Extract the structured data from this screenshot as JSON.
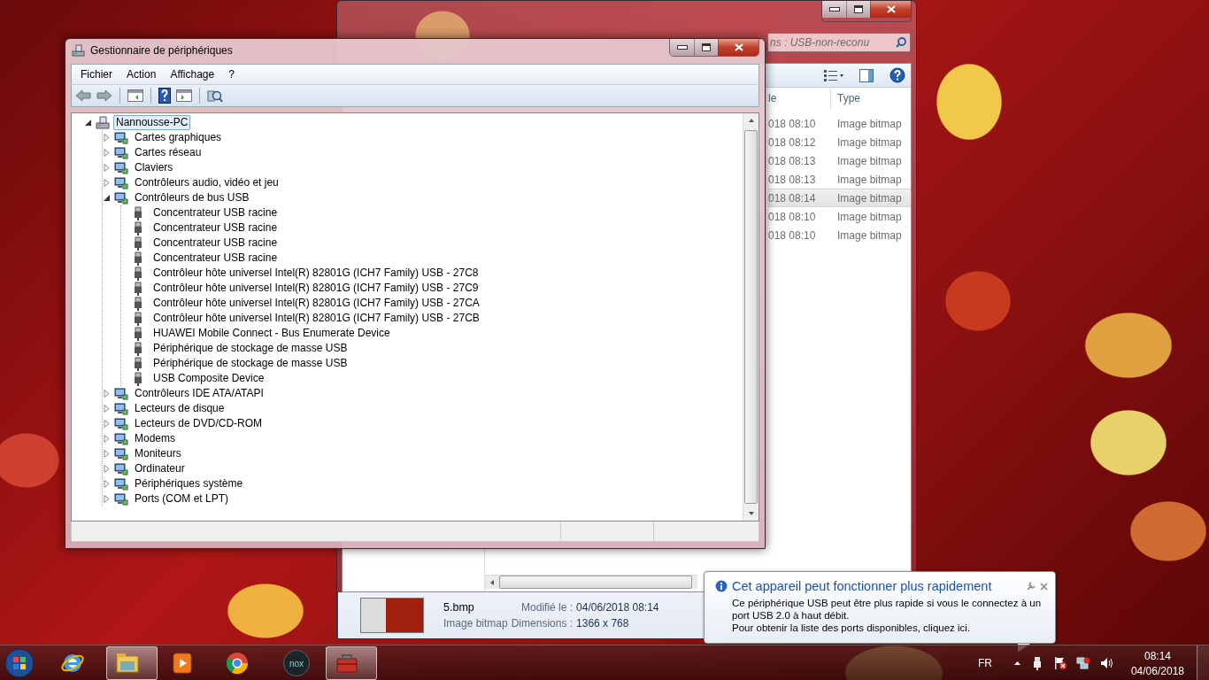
{
  "explorer": {
    "search": {
      "placeholder": "ns : USB-non-reconu"
    },
    "columns": [
      "le",
      "Type"
    ],
    "files": [
      {
        "date": "018 08:10",
        "type": "Image bitmap",
        "selected": false
      },
      {
        "date": "018 08:12",
        "type": "Image bitmap",
        "selected": false
      },
      {
        "date": "018 08:13",
        "type": "Image bitmap",
        "selected": false
      },
      {
        "date": "018 08:13",
        "type": "Image bitmap",
        "selected": false
      },
      {
        "date": "018 08:14",
        "type": "Image bitmap",
        "selected": true
      },
      {
        "date": "018 08:10",
        "type": "Image bitmap",
        "selected": false
      },
      {
        "date": "018 08:10",
        "type": "Image bitmap",
        "selected": false
      }
    ],
    "details": {
      "name": "5.bmp",
      "type": "Image bitmap",
      "fields": [
        {
          "label": "Modifié le :",
          "value": "04/06/2018 08:14"
        },
        {
          "label": "Dimensions :",
          "value": "1366 x 768"
        }
      ]
    }
  },
  "device_manager": {
    "title": "Gestionnaire de périphériques",
    "menu": [
      "Fichier",
      "Action",
      "Affichage",
      "?"
    ],
    "tree": [
      {
        "label": "Nannousse-PC",
        "expanded": true,
        "selected": true,
        "children": [
          {
            "label": "Cartes graphiques",
            "expanded": false,
            "selected": false
          },
          {
            "label": "Cartes réseau",
            "expanded": false,
            "selected": false
          },
          {
            "label": "Claviers",
            "expanded": false,
            "selected": false
          },
          {
            "label": "Contrôleurs audio, vidéo et jeu",
            "expanded": false,
            "selected": false
          },
          {
            "label": "Contrôleurs de bus USB",
            "expanded": true,
            "selected": false,
            "children": [
              {
                "label": "Concentrateur USB racine",
                "selected": false
              },
              {
                "label": "Concentrateur USB racine",
                "selected": false
              },
              {
                "label": "Concentrateur USB racine",
                "selected": false
              },
              {
                "label": "Concentrateur USB racine",
                "selected": false
              },
              {
                "label": "Contrôleur hôte universel Intel(R) 82801G (ICH7 Family) USB - 27C8",
                "selected": false
              },
              {
                "label": "Contrôleur hôte universel Intel(R) 82801G (ICH7 Family) USB - 27C9",
                "selected": false
              },
              {
                "label": "Contrôleur hôte universel Intel(R) 82801G (ICH7 Family) USB - 27CA",
                "selected": false
              },
              {
                "label": "Contrôleur hôte universel Intel(R) 82801G (ICH7 Family) USB - 27CB",
                "selected": false
              },
              {
                "label": "HUAWEI Mobile Connect - Bus Enumerate Device",
                "selected": false
              },
              {
                "label": "Périphérique de stockage de masse USB",
                "selected": false
              },
              {
                "label": "Périphérique de stockage de masse USB",
                "selected": false
              },
              {
                "label": "USB Composite Device",
                "selected": false
              }
            ]
          },
          {
            "label": "Contrôleurs IDE ATA/ATAPI",
            "expanded": false,
            "selected": false
          },
          {
            "label": "Lecteurs de disque",
            "expanded": false,
            "selected": false
          },
          {
            "label": "Lecteurs de DVD/CD-ROM",
            "expanded": false,
            "selected": false
          },
          {
            "label": "Modems",
            "expanded": false,
            "selected": false
          },
          {
            "label": "Moniteurs",
            "expanded": false,
            "selected": false
          },
          {
            "label": "Ordinateur",
            "expanded": false,
            "selected": false
          },
          {
            "label": "Périphériques système",
            "expanded": false,
            "selected": false
          },
          {
            "label": "Ports (COM et LPT)",
            "expanded": false,
            "selected": false
          }
        ]
      }
    ]
  },
  "notification": {
    "title": "Cet appareil peut fonctionner plus rapidement",
    "lines": [
      "Ce périphérique USB peut être plus rapide si vous le connectez à un port USB 2.0 à haut débit.",
      "Pour obtenir la liste des ports disponibles, cliquez ici."
    ]
  },
  "taskbar": {
    "apps": [
      {
        "kind": "ie",
        "active": false
      },
      {
        "kind": "explorer",
        "active": true
      },
      {
        "kind": "media",
        "active": false
      },
      {
        "kind": "chrome",
        "active": false
      },
      {
        "kind": "nox",
        "label": "nox",
        "active": false
      },
      {
        "kind": "devmgr",
        "active": true
      }
    ],
    "language": "FR",
    "time": "08:14",
    "date": "04/06/2018"
  }
}
